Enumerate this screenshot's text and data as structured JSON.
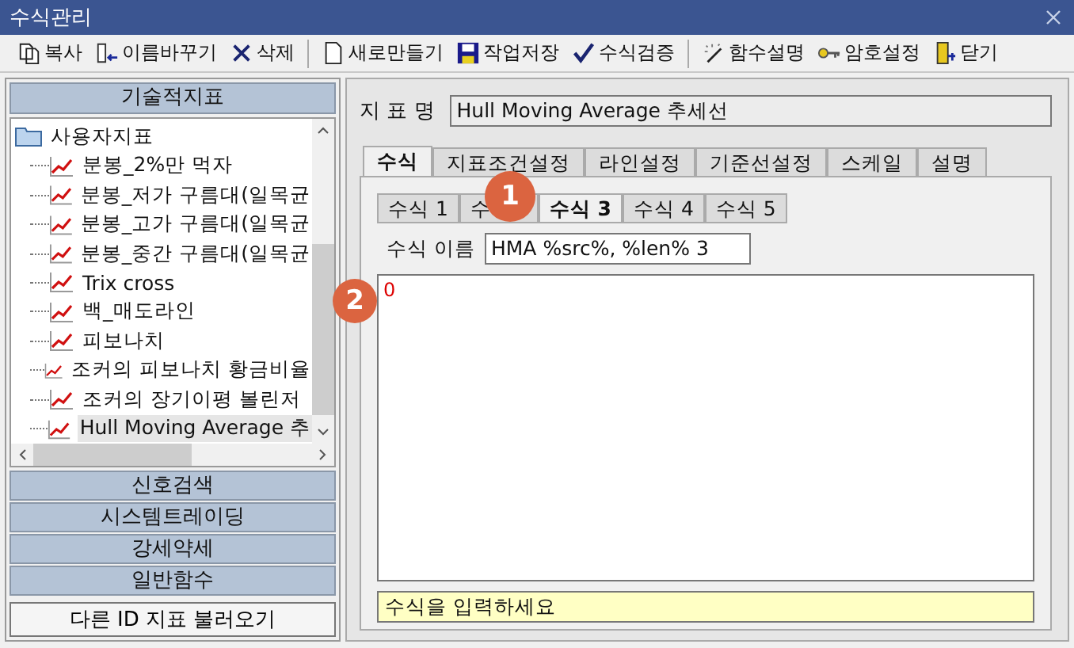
{
  "window": {
    "title": "수식관리"
  },
  "toolbar": [
    "복사",
    "이름바꾸기",
    "삭제",
    "새로만들기",
    "작업저장",
    "수식검증",
    "함수설명",
    "암호설정",
    "닫기"
  ],
  "sidebar": {
    "header": "기술적지표",
    "tree": {
      "label": "사용자지표",
      "expanded": true,
      "children": [
        {
          "label": "분봉_2%만 먹자",
          "selected": false
        },
        {
          "label": "분봉_저가 구름대(일목균",
          "selected": false
        },
        {
          "label": "분봉_고가 구름대(일목균",
          "selected": false
        },
        {
          "label": "분봉_중간 구름대(일목균",
          "selected": false
        },
        {
          "label": "Trix cross",
          "selected": false
        },
        {
          "label": "백_매도라인",
          "selected": false
        },
        {
          "label": "피보나치",
          "selected": false
        },
        {
          "label": "조커의 피보나치 황금비율",
          "selected": false
        },
        {
          "label": "조커의 장기이평 볼린저",
          "selected": false
        },
        {
          "label": "Hull Moving Average 추",
          "selected": true
        }
      ]
    },
    "sections": [
      "신호검색",
      "시스템트레이딩",
      "강세약세",
      "일반함수"
    ],
    "load_button": "다른 ID 지표 불러오기"
  },
  "indicator_name": {
    "label": "지 표 명",
    "value": "Hull Moving Average 추세선"
  },
  "tabs": [
    {
      "label": "수식",
      "selected": true
    },
    {
      "label": "지표조건설정",
      "selected": false
    },
    {
      "label": "라인설정",
      "selected": false
    },
    {
      "label": "기준선설정",
      "selected": false
    },
    {
      "label": "스케일",
      "selected": false
    },
    {
      "label": "설명",
      "selected": false
    }
  ],
  "formula_tabs": [
    {
      "label": "수식 1",
      "selected": false
    },
    {
      "label": "수",
      "selected": false
    },
    {
      "label": "수식 3",
      "selected": true
    },
    {
      "label": "수식 4",
      "selected": false
    },
    {
      "label": "수식 5",
      "selected": false
    }
  ],
  "formula_name": {
    "label": "수식 이름",
    "value": "HMA %src%, %len% 3"
  },
  "formula_text": "0",
  "hint": "수식을 입력하세요",
  "callouts": [
    "1",
    "2"
  ]
}
